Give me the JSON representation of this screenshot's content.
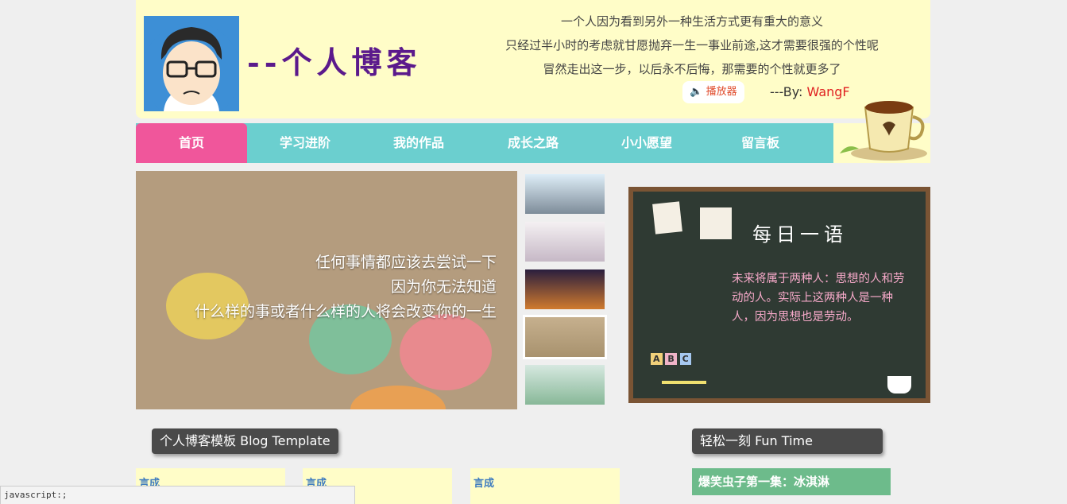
{
  "header": {
    "logo_text": "--个人博客",
    "quotes": [
      "一个人因为看到另外一种生活方式更有重大的意义",
      "只经过半小时的考虑就甘愿抛弃一生一事业前途,这才需要很强的个性呢",
      "冒然走出这一步，以后永不后悔，那需要的个性就更多了"
    ],
    "player_label": "播放器",
    "by_prefix": "---By: ",
    "by_name": "WangF"
  },
  "nav": {
    "items": [
      "首页",
      "学习进阶",
      "我的作品",
      "成长之路",
      "小小愿望",
      "留言板"
    ],
    "active_index": 0
  },
  "slider": {
    "caption": [
      "任何事情都应该去尝试一下",
      "因为你无法知道",
      "什么样的事或者什么样的人将会改变你的一生"
    ],
    "selected_thumb": 3
  },
  "board": {
    "title": "每日一语",
    "text": "未来将属于两种人：思想的人和劳动的人。实际上这两种人是一种人，因为思想也是劳动。"
  },
  "sections": {
    "blog_title": "个人博客模板 Blog Template",
    "fun_title": "轻松一刻 Fun Time",
    "fun_link": "爆笑虫子第一集：冰淇淋",
    "card_title": "言成"
  },
  "status_bar": "javascript:;",
  "colors": {
    "header_bg": "#fffdc8",
    "nav_bg": "#6bcfcf",
    "nav_active": "#f0569b",
    "fun_link_bg": "#6dbb8b"
  }
}
